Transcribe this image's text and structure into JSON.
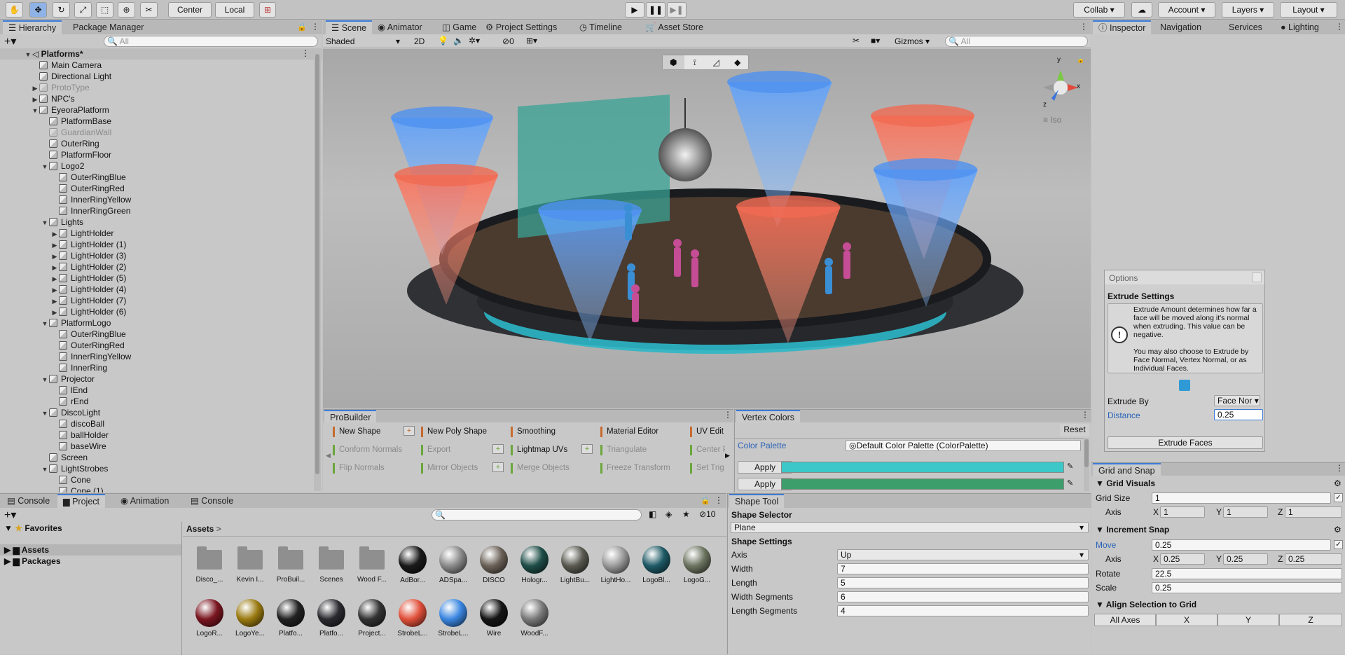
{
  "toolbar": {
    "pivot_center": "Center",
    "pivot_local": "Local",
    "collab": "Collab",
    "account": "Account",
    "layers": "Layers",
    "layout": "Layout"
  },
  "hierarchy": {
    "tab": "Hierarchy",
    "tab2": "Package Manager",
    "search_placeholder": "All",
    "scene_name": "Platforms*",
    "rows": [
      {
        "label": "Main Camera",
        "indent": 1,
        "arrow": "",
        "dim": false
      },
      {
        "label": "Directional Light",
        "indent": 1,
        "arrow": "",
        "dim": false
      },
      {
        "label": "ProtoType",
        "indent": 1,
        "arrow": "▶",
        "dim": true
      },
      {
        "label": "NPC's",
        "indent": 1,
        "arrow": "▶",
        "dim": false
      },
      {
        "label": "EyeoraPlatform",
        "indent": 1,
        "arrow": "▼",
        "dim": false
      },
      {
        "label": "PlatformBase",
        "indent": 2,
        "arrow": "",
        "dim": false
      },
      {
        "label": "GuardianWall",
        "indent": 2,
        "arrow": "",
        "dim": true
      },
      {
        "label": "OuterRing",
        "indent": 2,
        "arrow": "",
        "dim": false
      },
      {
        "label": "PlatformFloor",
        "indent": 2,
        "arrow": "",
        "dim": false
      },
      {
        "label": "Logo2",
        "indent": 2,
        "arrow": "▼",
        "dim": false
      },
      {
        "label": "OuterRingBlue",
        "indent": 3,
        "arrow": "",
        "dim": false
      },
      {
        "label": "OuterRingRed",
        "indent": 3,
        "arrow": "",
        "dim": false
      },
      {
        "label": "InnerRingYellow",
        "indent": 3,
        "arrow": "",
        "dim": false
      },
      {
        "label": "InnerRingGreen",
        "indent": 3,
        "arrow": "",
        "dim": false
      },
      {
        "label": "Lights",
        "indent": 2,
        "arrow": "▼",
        "dim": false
      },
      {
        "label": "LightHolder",
        "indent": 3,
        "arrow": "▶",
        "dim": false
      },
      {
        "label": "LightHolder (1)",
        "indent": 3,
        "arrow": "▶",
        "dim": false
      },
      {
        "label": "LightHolder (3)",
        "indent": 3,
        "arrow": "▶",
        "dim": false
      },
      {
        "label": "LightHolder (2)",
        "indent": 3,
        "arrow": "▶",
        "dim": false
      },
      {
        "label": "LightHolder (5)",
        "indent": 3,
        "arrow": "▶",
        "dim": false
      },
      {
        "label": "LightHolder (4)",
        "indent": 3,
        "arrow": "▶",
        "dim": false
      },
      {
        "label": "LightHolder (7)",
        "indent": 3,
        "arrow": "▶",
        "dim": false
      },
      {
        "label": "LightHolder (6)",
        "indent": 3,
        "arrow": "▶",
        "dim": false
      },
      {
        "label": "PlatformLogo",
        "indent": 2,
        "arrow": "▼",
        "dim": false
      },
      {
        "label": "OuterRingBlue",
        "indent": 3,
        "arrow": "",
        "dim": false
      },
      {
        "label": "OuterRingRed",
        "indent": 3,
        "arrow": "",
        "dim": false
      },
      {
        "label": "InnerRingYellow",
        "indent": 3,
        "arrow": "",
        "dim": false
      },
      {
        "label": "InnerRing",
        "indent": 3,
        "arrow": "",
        "dim": false
      },
      {
        "label": "Projector",
        "indent": 2,
        "arrow": "▼",
        "dim": false
      },
      {
        "label": "lEnd",
        "indent": 3,
        "arrow": "",
        "dim": false
      },
      {
        "label": "rEnd",
        "indent": 3,
        "arrow": "",
        "dim": false
      },
      {
        "label": "DiscoLight",
        "indent": 2,
        "arrow": "▼",
        "dim": false
      },
      {
        "label": "discoBall",
        "indent": 3,
        "arrow": "",
        "dim": false
      },
      {
        "label": "ballHolder",
        "indent": 3,
        "arrow": "",
        "dim": false
      },
      {
        "label": "baseWire",
        "indent": 3,
        "arrow": "",
        "dim": false
      },
      {
        "label": "Screen",
        "indent": 2,
        "arrow": "",
        "dim": false
      },
      {
        "label": "LightStrobes",
        "indent": 2,
        "arrow": "▼",
        "dim": false
      },
      {
        "label": "Cone",
        "indent": 3,
        "arrow": "",
        "dim": false
      },
      {
        "label": "Cone (1)",
        "indent": 3,
        "arrow": "",
        "dim": false
      }
    ]
  },
  "scene": {
    "tabs": [
      "Scene",
      "Animator",
      "Game",
      "Project Settings",
      "Timeline",
      "Asset Store"
    ],
    "shading": "Shaded",
    "mode_2d": "2D",
    "hidden_count": "0",
    "gizmos": "Gizmos",
    "search_placeholder": "All",
    "iso_label": "Iso",
    "axis_x": "x",
    "axis_y": "y",
    "axis_z": "z"
  },
  "inspector": {
    "tabs": [
      "Inspector",
      "Navigation",
      "Services",
      "Lighting"
    ]
  },
  "options": {
    "title": "Options",
    "section": "Extrude Settings",
    "help_text_1": "Extrude Amount determines how far a face will be moved along it's normal when extruding.  This value can be negative.",
    "help_text_2": "You may also choose to Extrude by Face Normal, Vertex Normal, or as Individual Faces.",
    "extrude_by_label": "Extrude By",
    "extrude_by_value": "Face Nor",
    "distance_label": "Distance",
    "distance_value": "0.25",
    "extrude_button": "Extrude Faces"
  },
  "probuilder": {
    "tab": "ProBuilder",
    "items": [
      {
        "label": "New Shape",
        "dim": false,
        "green": false
      },
      {
        "label": "New Poly Shape",
        "dim": false,
        "green": false
      },
      {
        "label": "Smoothing",
        "dim": false,
        "green": false
      },
      {
        "label": "Material Editor",
        "dim": false,
        "green": false
      },
      {
        "label": "UV Edit",
        "dim": false,
        "green": false
      },
      {
        "label": "Conform Normals",
        "dim": true,
        "green": true
      },
      {
        "label": "Export",
        "dim": true,
        "green": true
      },
      {
        "label": "Lightmap UVs",
        "dim": false,
        "green": true
      },
      {
        "label": "Triangulate",
        "dim": true,
        "green": true
      },
      {
        "label": "Center P",
        "dim": true,
        "green": true
      },
      {
        "label": "Flip Normals",
        "dim": true,
        "green": true
      },
      {
        "label": "Mirror Objects",
        "dim": true,
        "green": true
      },
      {
        "label": "Merge Objects",
        "dim": true,
        "green": true
      },
      {
        "label": "Freeze Transform",
        "dim": true,
        "green": true
      },
      {
        "label": "Set Trig",
        "dim": true,
        "green": true
      }
    ]
  },
  "vertex_colors": {
    "tab": "Vertex Colors",
    "reset": "Reset",
    "palette_label": "Color Palette",
    "palette_value": "Default Color Palette (ColorPalette)",
    "apply": "Apply",
    "color1": "#3cc8c8",
    "color2": "#3c9e6a"
  },
  "grid_snap": {
    "tab": "Grid and Snap",
    "grid_visuals": "Grid Visuals",
    "grid_size_label": "Grid Size",
    "grid_size": "1",
    "axis_label": "Axis",
    "axis_x": "1",
    "axis_y": "1",
    "axis_z": "1",
    "increment_snap": "Increment Snap",
    "move_label": "Move",
    "move": "0.25",
    "inc_x": "0.25",
    "inc_y": "0.25",
    "inc_z": "0.25",
    "rotate_label": "Rotate",
    "rotate": "22.5",
    "scale_label": "Scale",
    "scale": "0.25",
    "align": "Align Selection to Grid",
    "all_axes": "All Axes",
    "bx": "X",
    "by": "Y",
    "bz": "Z"
  },
  "project": {
    "tabs": [
      "Console",
      "Project",
      "Animation",
      "Console"
    ],
    "hidden_count": "10",
    "favorites": "Favorites",
    "assets": "Assets",
    "packages": "Packages",
    "breadcrumb": "Assets",
    "items": [
      {
        "label": "Disco_...",
        "kind": "folder",
        "color": ""
      },
      {
        "label": "Kevin I...",
        "kind": "folder",
        "color": ""
      },
      {
        "label": "ProBuil...",
        "kind": "folder",
        "color": ""
      },
      {
        "label": "Scenes",
        "kind": "folder",
        "color": ""
      },
      {
        "label": "Wood F...",
        "kind": "folder",
        "color": ""
      },
      {
        "label": "AdBor...",
        "kind": "mat",
        "color": "#1a1a1a"
      },
      {
        "label": "ADSpa...",
        "kind": "mat",
        "color": "#8a8a8a"
      },
      {
        "label": "DISCO",
        "kind": "mat",
        "color": "#6b6258"
      },
      {
        "label": "Hologr...",
        "kind": "mat",
        "color": "#1f4e48"
      },
      {
        "label": "LightBu...",
        "kind": "mat",
        "color": "#5a5a52"
      },
      {
        "label": "LightHo...",
        "kind": "mat",
        "color": "#9a9a9a"
      },
      {
        "label": "LogoBl...",
        "kind": "mat",
        "color": "#1e5a66"
      },
      {
        "label": "LogoG...",
        "kind": "mat",
        "color": "#6c7460"
      },
      {
        "label": "LogoR...",
        "kind": "mat",
        "color": "#7a1620"
      },
      {
        "label": "LogoYe...",
        "kind": "mat",
        "color": "#9a7a10"
      },
      {
        "label": "Platfo...",
        "kind": "mat",
        "color": "#222"
      },
      {
        "label": "Platfo...",
        "kind": "mat",
        "color": "#2a2a30"
      },
      {
        "label": "Project...",
        "kind": "mat",
        "color": "#333"
      },
      {
        "label": "StrobeL...",
        "kind": "mat",
        "color": "#e0503a"
      },
      {
        "label": "StrobeL...",
        "kind": "mat",
        "color": "#3a86e0"
      },
      {
        "label": "Wire",
        "kind": "mat",
        "color": "#151515"
      },
      {
        "label": "WoodF...",
        "kind": "mat",
        "color": "#7a7a7a"
      }
    ]
  },
  "shape_tool": {
    "tab": "Shape Tool",
    "selector": "Shape Selector",
    "shape": "Plane",
    "settings": "Shape Settings",
    "fields": [
      {
        "label": "Axis",
        "value": "Up"
      },
      {
        "label": "Width",
        "value": "7"
      },
      {
        "label": "Length",
        "value": "5"
      },
      {
        "label": "Width Segments",
        "value": "6"
      },
      {
        "label": "Length Segments",
        "value": "4"
      }
    ]
  }
}
